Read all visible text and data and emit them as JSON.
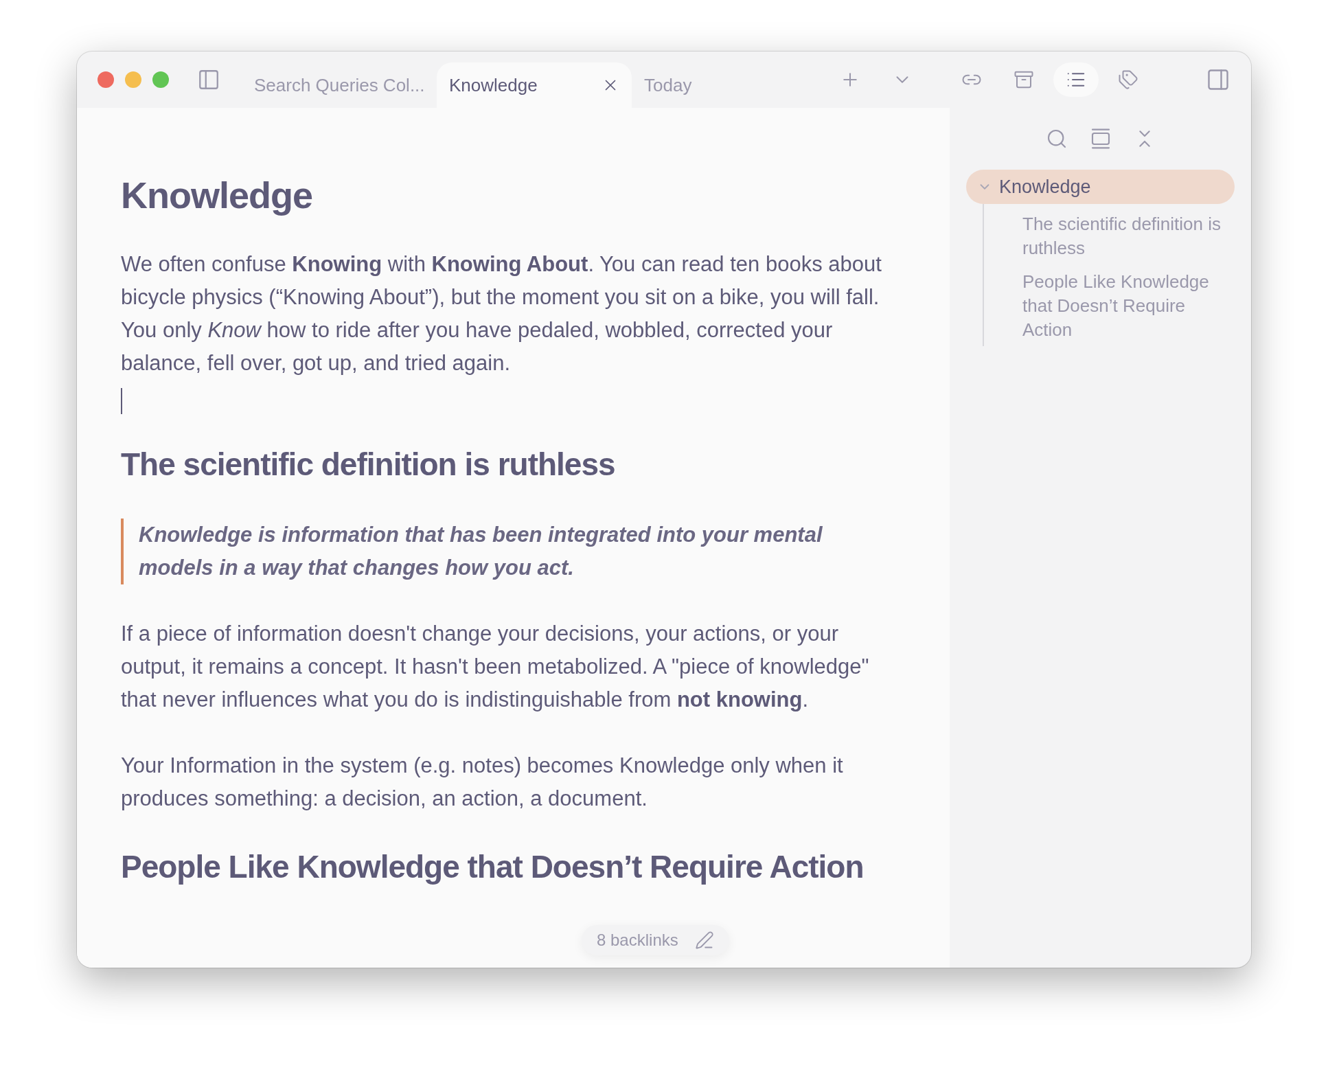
{
  "tabs": [
    {
      "label": "Search Queries Col...",
      "selected": false
    },
    {
      "label": "Knowledge",
      "selected": true
    },
    {
      "label": "Today",
      "selected": false
    }
  ],
  "toolbar": [
    {
      "selected": false
    },
    {
      "selected": false
    },
    {
      "selected": true
    },
    {
      "selected": false
    }
  ],
  "document": [
    {
      "kind": "h1",
      "text": "Knowledge"
    },
    {
      "kind": "p",
      "text": "We often confuse **Knowing** with **Knowing About**. You can read ten books about bicycle physics (“Knowing About”), but the moment you sit on a bike, you will fall. You only *Know* how to ride after you have pedaled, wobbled, corrected your balance, fell over, got up, and tried again."
    },
    {
      "kind": "caret"
    },
    {
      "kind": "h2",
      "text": "The scientific definition is ruthless"
    },
    {
      "kind": "quote",
      "text": "Knowledge is information that has been integrated into your mental models in a way that changes how you act."
    },
    {
      "kind": "p",
      "text": "If a piece of information doesn't change your decisions, your actions, or your output, it remains a concept. It hasn't been metabolized. A \"piece of knowledge\" that never influences what you do is indistinguishable from **not knowing**."
    },
    {
      "kind": "p",
      "text": "Your Information in the system (e.g. notes) becomes Knowledge only when it produces something: a decision, an action, a document."
    },
    {
      "kind": "h2",
      "text": "People Like Knowledge that Doesn’t Require Action"
    }
  ],
  "backlinks": "8 backlinks",
  "outline": [
    {
      "label": "Knowledge",
      "selected": true,
      "expanded": true,
      "children": [
        {
          "label": "The scientific definition is ruthless",
          "selected": false
        },
        {
          "label": "People Like Knowledge that Doesn’t Require Action",
          "selected": false
        }
      ]
    }
  ]
}
